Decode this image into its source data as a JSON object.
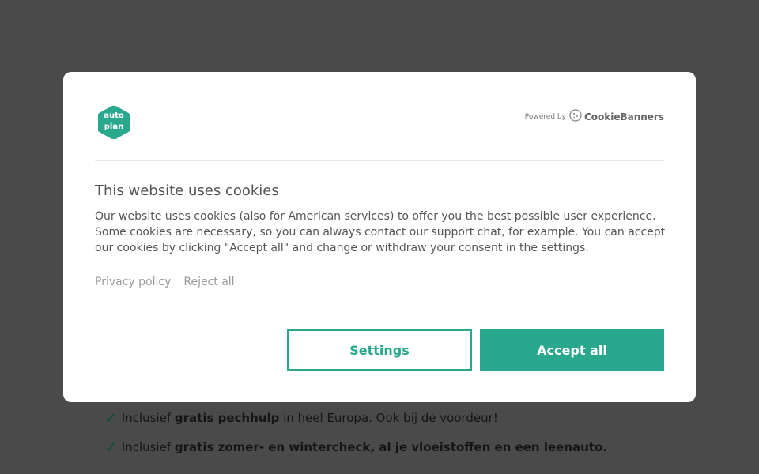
{
  "background": {
    "items": [
      {
        "prefix": "Inclusief ",
        "bold": "gratis pechhulp",
        "suffix": " in heel Europa. Ook bij de voordeur!"
      },
      {
        "prefix": "Inclusief ",
        "bold": "gratis zomer- en wintercheck, al je vloeistoffen en een leenauto.",
        "suffix": ""
      }
    ]
  },
  "modal": {
    "logo": {
      "line1": "auto",
      "line2": "plan"
    },
    "powered": {
      "label": "Powered by",
      "brand": "CookieBanners"
    },
    "title": "This website uses cookies",
    "body": "Our website uses cookies (also for American services) to offer you the best possible user experience. Some cookies are necessary, so you can always contact our support chat, for example. You can accept our cookies by clicking \"Accept all\" and change or withdraw your consent in the settings.",
    "links": {
      "privacy": "Privacy policy",
      "reject": "Reject all"
    },
    "buttons": {
      "settings": "Settings",
      "accept": "Accept all"
    }
  },
  "colors": {
    "accent": "#2aa88e",
    "overlay": "#4a4a4a"
  }
}
